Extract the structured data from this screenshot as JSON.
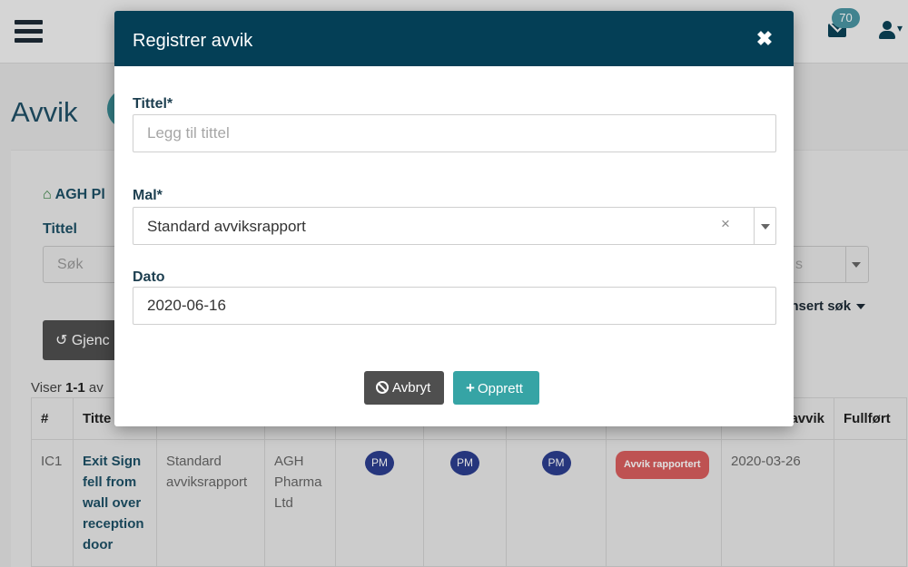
{
  "header": {
    "notification_count": "70",
    "icons": [
      "menu-icon",
      "mail-icon",
      "user-icon",
      "chevron-down-icon"
    ]
  },
  "page": {
    "title": "Avvik",
    "breadcrumb": "AGH Pl",
    "filter_label": "Tittel",
    "search_placeholder": "Søk",
    "status_placeholder": "s",
    "advanced_search": "ansert søk",
    "reset_label": "Gjenc",
    "showing_prefix": "Viser ",
    "showing_range": "1-1",
    "showing_suffix": " av ",
    "table": {
      "headers": [
        "#",
        "Titte",
        "",
        "",
        "",
        "",
        "",
        "",
        "avvik",
        "Fullført"
      ],
      "rows": [
        {
          "id": "IC1",
          "title": "Exit Sign fell from wall over reception door",
          "template": "Standard avviksrapport",
          "company": "AGH Pharma Ltd",
          "avatar1": "PM",
          "avatar2": "PM",
          "avatar3": "PM",
          "status": "Avvik rapportert",
          "date": "2020-03-26",
          "completed": ""
        }
      ]
    }
  },
  "modal": {
    "title": "Registrer avvik",
    "close_symbol": "✖",
    "title_field": {
      "label": "Tittel*",
      "placeholder": "Legg til tittel",
      "value": ""
    },
    "template_field": {
      "label": "Mal*",
      "value": "Standard avviksrapport",
      "clear_symbol": "×"
    },
    "date_field": {
      "label": "Dato",
      "value": "2020-06-16"
    },
    "cancel_label": "Avbryt",
    "create_label": "Opprett"
  },
  "colors": {
    "modal_header": "#043f56",
    "create_button": "#36a4a5",
    "cancel_button": "#4f4f4f",
    "status_pill": "#d95e5e",
    "avatar": "#2c3e8f"
  }
}
